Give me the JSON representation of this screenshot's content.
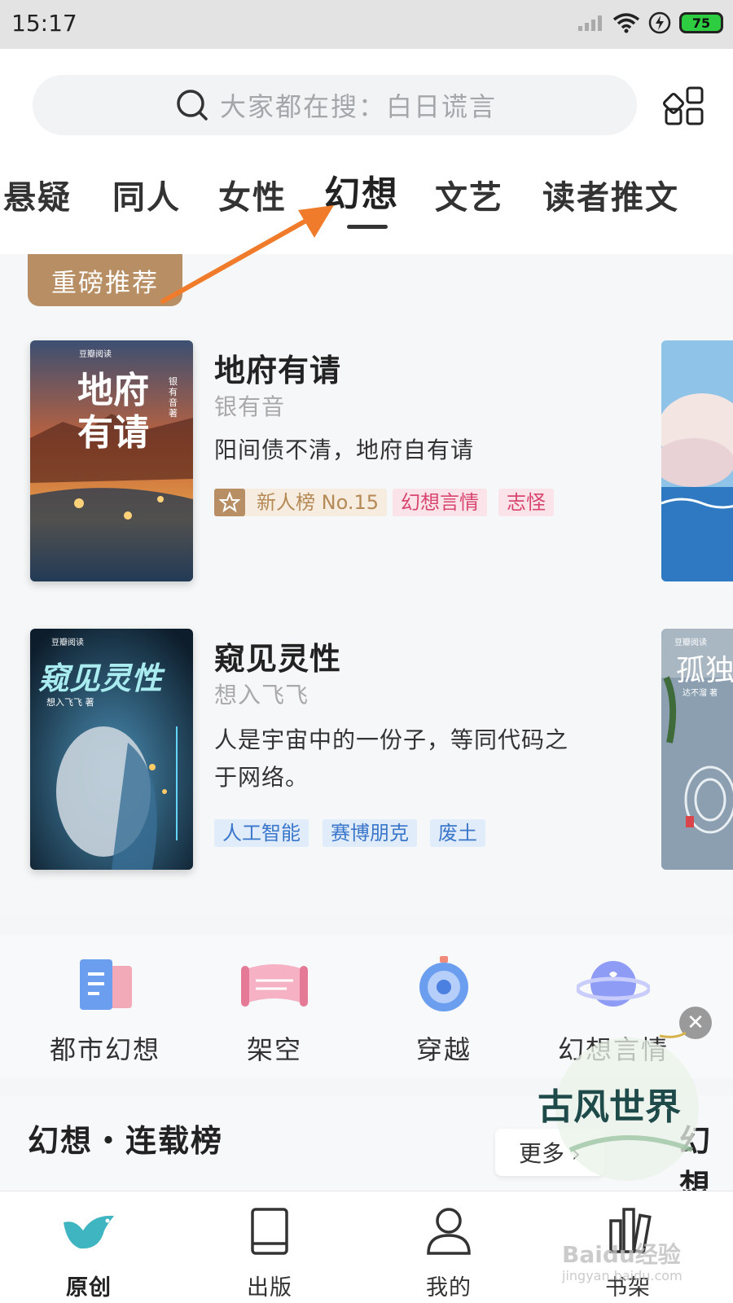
{
  "status_bar": {
    "time": "15:17",
    "battery": "75"
  },
  "search": {
    "placeholder": "大家都在搜：白日谎言"
  },
  "tabs": [
    "悬疑",
    "同人",
    "女性",
    "幻想",
    "文艺",
    "读者推文"
  ],
  "active_tab": "幻想",
  "featured": {
    "badge": "重磅推荐",
    "books": [
      {
        "title": "地府有请",
        "author": "银有音",
        "description": "阳间债不清，地府自有请",
        "cover_title": "地府有请",
        "cover_author": "银有音 著",
        "tags": [
          {
            "label": "新人榜 No.15",
            "style": "gold"
          },
          {
            "label": "幻想言情",
            "style": "pink"
          },
          {
            "label": "志怪",
            "style": "pink"
          }
        ]
      },
      {
        "title": "窥见灵性",
        "author": "想入飞飞",
        "description_line1": "人是宇宙中的一份子，等同代码之",
        "description_line2": "于网络。",
        "cover_title": "窥见灵性",
        "cover_author": "想入飞飞 著",
        "tags": [
          {
            "label": "人工智能",
            "style": "blue"
          },
          {
            "label": "赛博朋克",
            "style": "blue"
          },
          {
            "label": "废土",
            "style": "blue"
          }
        ]
      }
    ],
    "peek_cover_title": "孤独",
    "peek_cover_author": "达不溜 著",
    "cover_brand": "豆瓣阅读"
  },
  "categories": [
    {
      "label": "都市幻想",
      "icon": "book-icon"
    },
    {
      "label": "架空",
      "icon": "scroll-icon"
    },
    {
      "label": "穿越",
      "icon": "stopwatch-icon"
    },
    {
      "label": "幻想言情",
      "icon": "planet-icon"
    }
  ],
  "ranking": {
    "title": "幻想・连载榜",
    "more": "更多 ›",
    "peek": "幻想"
  },
  "watermark": {
    "text": "古风世界",
    "baidu": "Baidu经验",
    "baidu_sub": "jingyan.baidu.com"
  },
  "bottom_nav": [
    {
      "label": "原创",
      "icon": "bird-icon",
      "active": true
    },
    {
      "label": "出版",
      "icon": "book-icon",
      "active": false
    },
    {
      "label": "我的",
      "icon": "person-icon",
      "active": false
    },
    {
      "label": "书架",
      "icon": "bookshelf-icon",
      "active": false
    }
  ],
  "colors": {
    "accent_gold": "#b88f65",
    "tag_pink": "#d8466f",
    "tag_blue": "#3a76c9",
    "arrow": "#f07c2b",
    "nav_active": "#3fb5c1"
  }
}
